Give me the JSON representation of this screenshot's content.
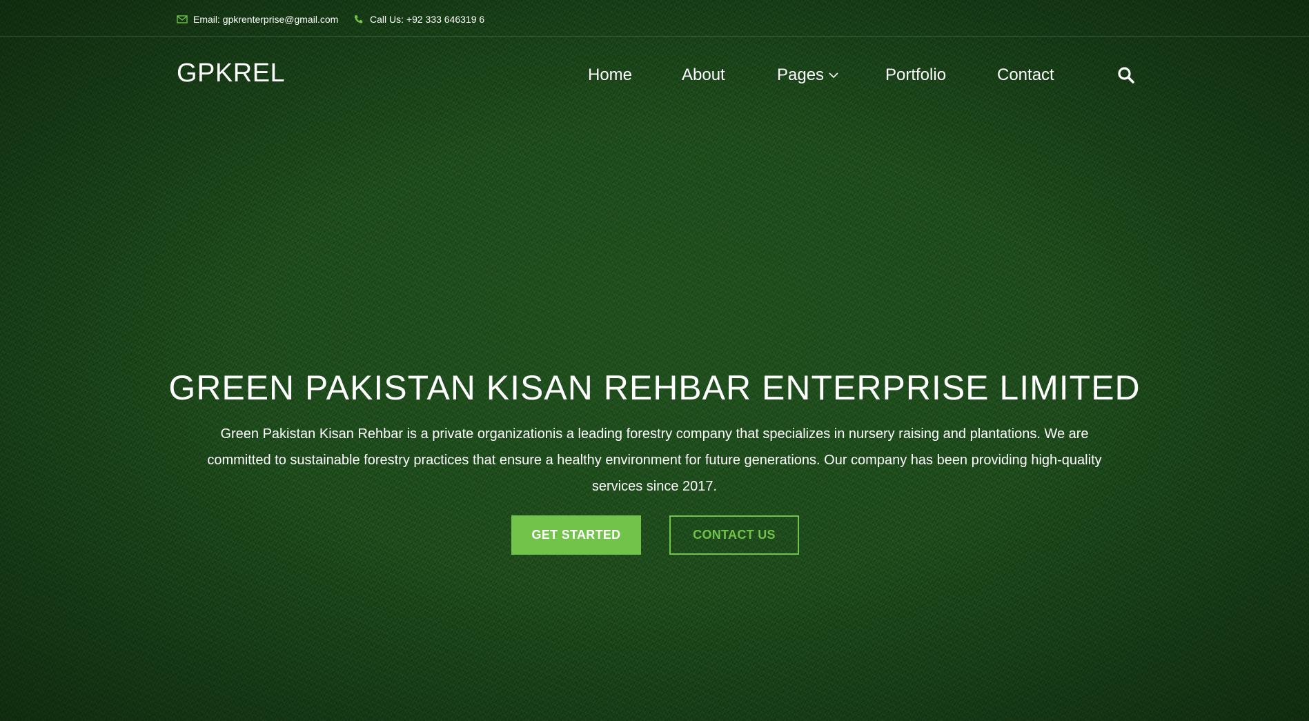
{
  "topbar": {
    "email": "Email: gpkrenterprise@gmail.com",
    "phone": "Call Us: +92 333 646319 6"
  },
  "header": {
    "logo": "GPKREL",
    "nav": {
      "home": "Home",
      "about": "About",
      "pages": "Pages",
      "portfolio": "Portfolio",
      "contact": "Contact"
    }
  },
  "hero": {
    "title": "GREEN PAKISTAN KISAN REHBAR ENTERPRISE LIMITED",
    "description": "Green Pakistan Kisan Rehbar is a private organizationis a leading forestry company that specializes in nursery raising and plantations. We are committed to sustainable forestry practices that ensure a healthy environment for future generations. Our company has been providing high-quality services since 2017.",
    "primary_button": "GET STARTED",
    "secondary_button": "CONTACT US"
  },
  "icons": {
    "email": "envelope-icon",
    "phone": "phone-icon",
    "search": "search-icon",
    "dropdown": "chevron-down-icon"
  },
  "colors": {
    "accent": "#72c34a",
    "background": "#1d4b1c",
    "text": "#ffffff"
  }
}
